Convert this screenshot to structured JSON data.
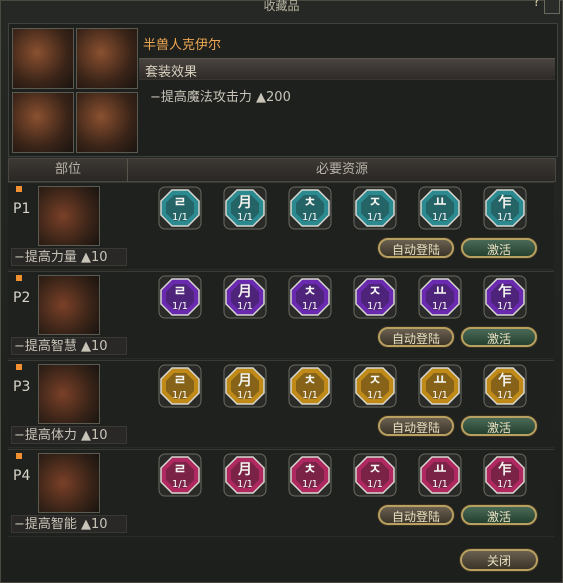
{
  "window": {
    "title": "收藏品",
    "help": "?"
  },
  "set": {
    "name": "半兽人克伊尔",
    "effect_title": "套装效果",
    "effect": "−提高魔法攻击力 ▲200"
  },
  "columns": {
    "part": "部位",
    "resources": "必要资源"
  },
  "colors": {
    "teal": "#2a8a90",
    "purple": "#6a2ab0",
    "gold": "#c08a18",
    "pink": "#b02860"
  },
  "glyphs": [
    "ㄹ",
    "月",
    "ㅊ",
    "ㅈ",
    "ㅛ",
    "乍"
  ],
  "rows": [
    {
      "label": "P1",
      "stat": "−提高力量 ▲10",
      "gem_color": "teal",
      "counts": [
        "1/1",
        "1/1",
        "1/1",
        "1/1",
        "1/1",
        "1/1"
      ],
      "auto_label": "自动登陆",
      "activate_label": "激活"
    },
    {
      "label": "P2",
      "stat": "−提高智慧 ▲10",
      "gem_color": "purple",
      "counts": [
        "1/1",
        "1/1",
        "1/1",
        "1/1",
        "1/1",
        "1/1"
      ],
      "auto_label": "自动登陆",
      "activate_label": "激活"
    },
    {
      "label": "P3",
      "stat": "−提高体力 ▲10",
      "gem_color": "gold",
      "counts": [
        "1/1",
        "1/1",
        "1/1",
        "1/1",
        "1/1",
        "1/1"
      ],
      "auto_label": "自动登陆",
      "activate_label": "激活"
    },
    {
      "label": "P4",
      "stat": "−提高智能 ▲10",
      "gem_color": "pink",
      "counts": [
        "1/1",
        "1/1",
        "1/1",
        "1/1",
        "1/1",
        "1/1"
      ],
      "auto_label": "自动登陆",
      "activate_label": "激活"
    }
  ],
  "footer": {
    "close_label": "关闭"
  }
}
